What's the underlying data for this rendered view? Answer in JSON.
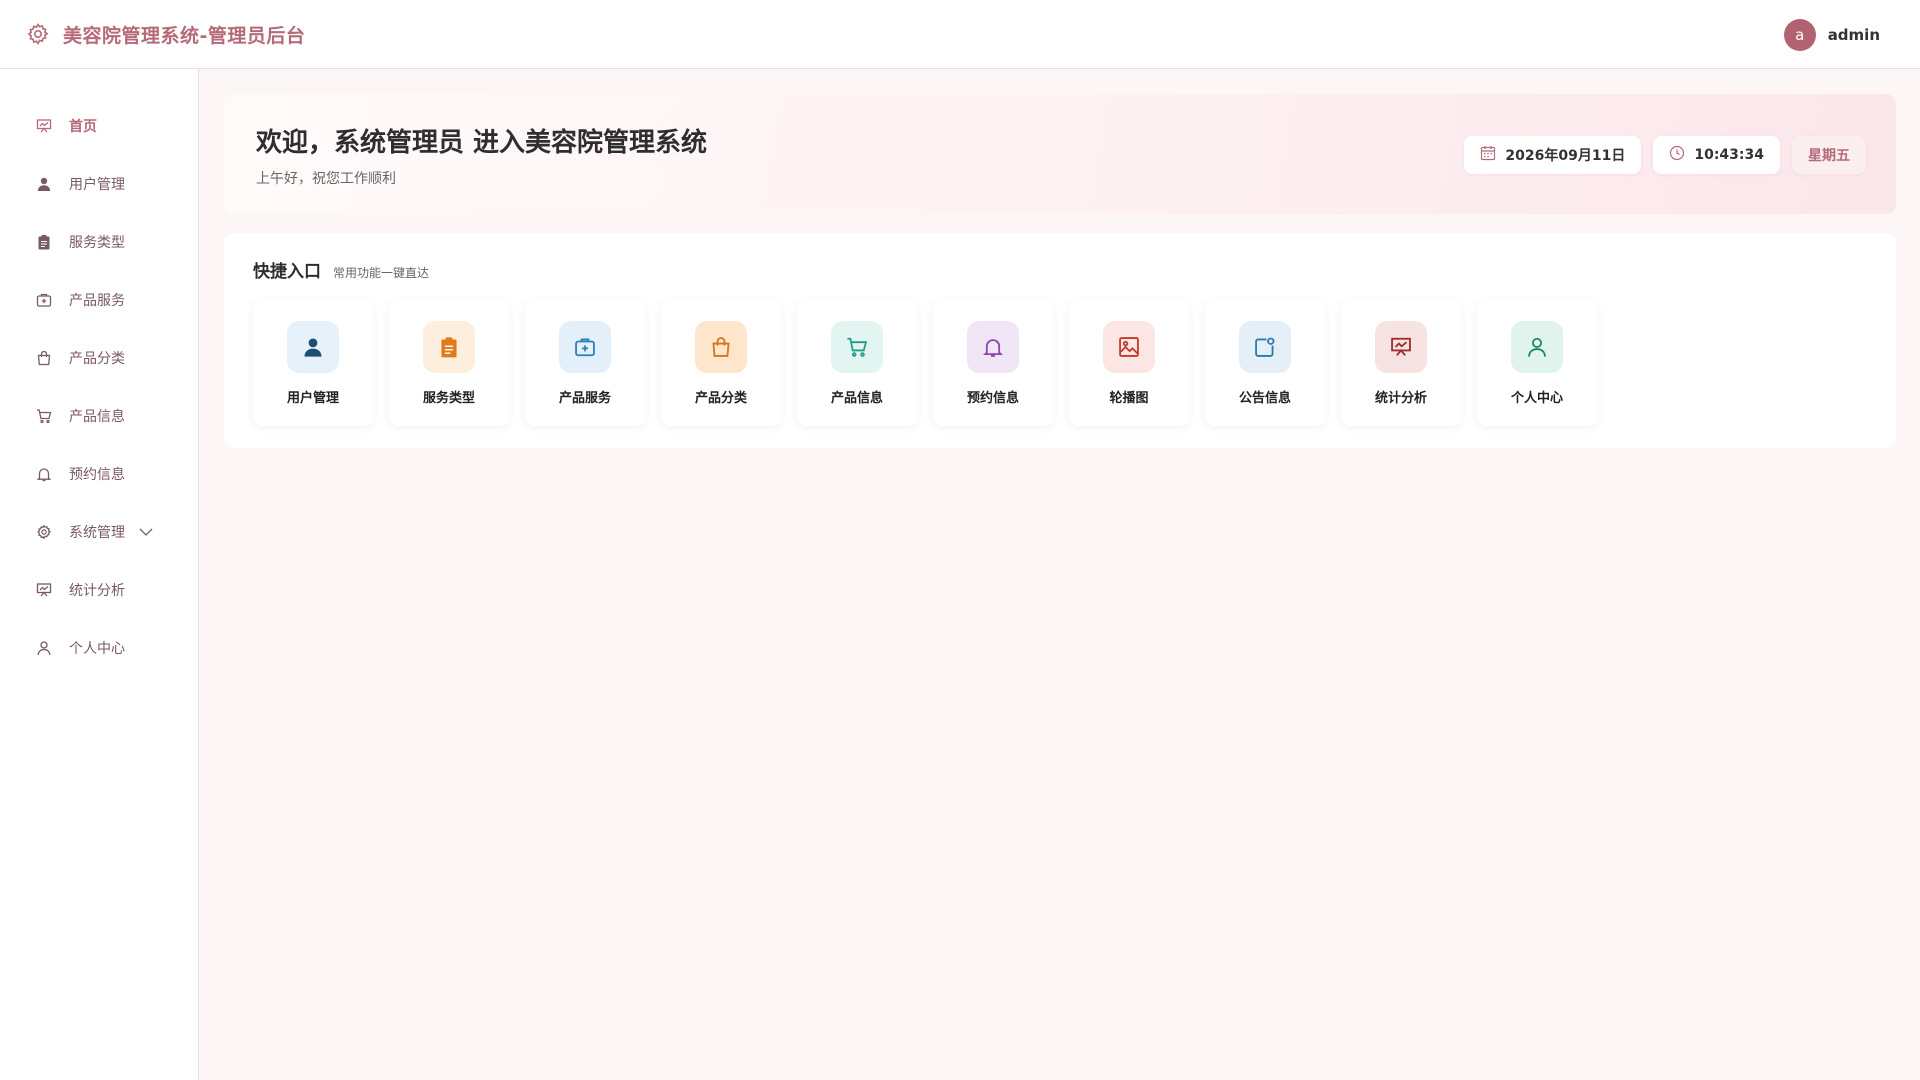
{
  "header": {
    "title": "美容院管理系统-管理员后台",
    "avatar_letter": "a",
    "user_name": "admin"
  },
  "sidebar": {
    "items": [
      {
        "label": "首页",
        "icon": "presentation-icon",
        "active": true
      },
      {
        "label": "用户管理",
        "icon": "user-icon"
      },
      {
        "label": "服务类型",
        "icon": "clipboard-icon"
      },
      {
        "label": "产品服务",
        "icon": "medical-kit-icon"
      },
      {
        "label": "产品分类",
        "icon": "shopping-bag-icon"
      },
      {
        "label": "产品信息",
        "icon": "cart-icon"
      },
      {
        "label": "预约信息",
        "icon": "bell-icon"
      },
      {
        "label": "系统管理",
        "icon": "gear-icon",
        "expandable": true
      },
      {
        "label": "统计分析",
        "icon": "presentation-icon"
      },
      {
        "label": "个人中心",
        "icon": "person-icon"
      }
    ]
  },
  "welcome": {
    "title": "欢迎，系统管理员 进入美容院管理系统",
    "subtitle": "上午好，祝您工作顺利",
    "date": "2026年09月11日",
    "time": "10:43:34",
    "weekday": "星期五"
  },
  "quick": {
    "title": "快捷入口",
    "subtitle": "常用功能一键直达",
    "cards": [
      {
        "label": "用户管理",
        "icon": "user-icon",
        "color": "#1d4f73",
        "bg": "#e6f1fa"
      },
      {
        "label": "服务类型",
        "icon": "clipboard-icon",
        "color": "#e07a1f",
        "bg": "#fdeedd"
      },
      {
        "label": "产品服务",
        "icon": "medical-kit-icon",
        "color": "#2d7fb8",
        "bg": "#e3f0fa"
      },
      {
        "label": "产品分类",
        "icon": "shopping-bag-icon",
        "color": "#d9731a",
        "bg": "#fde6cc"
      },
      {
        "label": "产品信息",
        "icon": "cart-icon",
        "color": "#1f9f8a",
        "bg": "#e2f5f0"
      },
      {
        "label": "预约信息",
        "icon": "bell-icon",
        "color": "#8e44ad",
        "bg": "#f1e6f6"
      },
      {
        "label": "轮播图",
        "icon": "image-icon",
        "color": "#c0392b",
        "bg": "#fbe6e4"
      },
      {
        "label": "公告信息",
        "icon": "notice-icon",
        "color": "#2a7ab0",
        "bg": "#e4eff7"
      },
      {
        "label": "统计分析",
        "icon": "presentation-icon",
        "color": "#9b2b2b",
        "bg": "#f8e3e3"
      },
      {
        "label": "个人中心",
        "icon": "person-icon",
        "color": "#1a8a6e",
        "bg": "#e0f3ed"
      }
    ]
  },
  "colors": {
    "accent": "#b56a78",
    "avatar_bg": "#b36272",
    "page_bg": "#fdf6f6"
  }
}
